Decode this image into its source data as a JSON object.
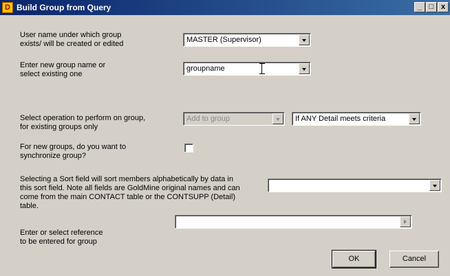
{
  "window": {
    "title": "Build Group from Query",
    "app_icon_letter": "D",
    "minimize": "_",
    "maximize": "□",
    "close": "x"
  },
  "user_name": {
    "label_line1": "User name under which group",
    "label_line2": "exists/ will be created or edited",
    "value": "MASTER (Supervisor)"
  },
  "group_name": {
    "label_line1": "Enter new group name or",
    "label_line2": "select existing one",
    "value": "groupname"
  },
  "operation": {
    "label_line1": "Select operation to perform on group,",
    "label_line2": "for existing groups only",
    "value": "Add to group",
    "criteria_value": "If ANY Detail meets criteria"
  },
  "synchronize": {
    "label_line1": "For new groups, do you want to",
    "label_line2": "synchronize group?",
    "checked": false
  },
  "sort_field": {
    "label_line1": "Selecting a Sort field will sort members alphabetically by data in",
    "label_line2": "this sort field. Note all fields are GoldMine original names and can",
    "label_line3": "come from the main CONTACT table or the CONTSUPP (Detail)",
    "label_line4": "table.",
    "value": ""
  },
  "reference": {
    "label_line1": "Enter or select reference",
    "label_line2": "to be entered for group",
    "value": ""
  },
  "buttons": {
    "ok": "OK",
    "cancel": "Cancel"
  },
  "colors": {
    "titlebar_start": "#0a246a",
    "titlebar_end": "#3a6ea5",
    "dialog_bg": "#d4d0c8"
  }
}
